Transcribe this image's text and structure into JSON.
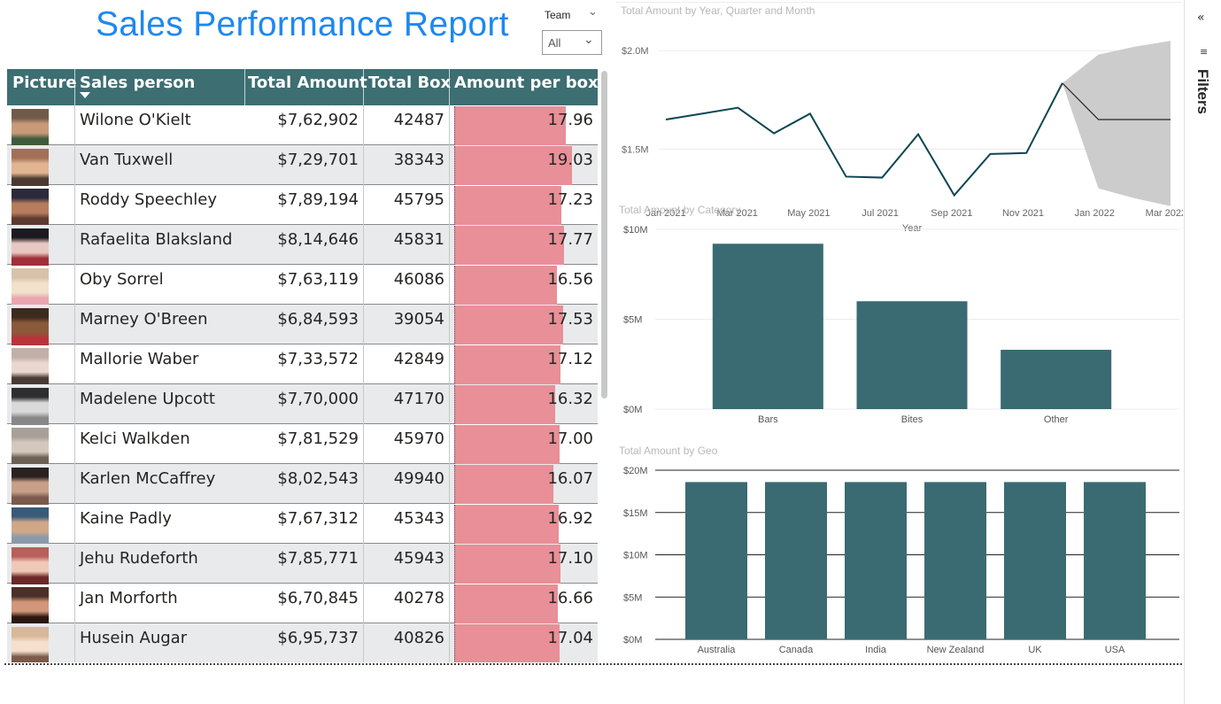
{
  "report": {
    "title": "Sales Performance Report"
  },
  "slicer": {
    "label": "Team",
    "value": "All"
  },
  "table": {
    "headers": [
      "Picture",
      "Sales person",
      "Total Amount",
      "Total Box",
      "Amount per box"
    ],
    "bar_color": "#e88f97",
    "header_color": "#3c6e72",
    "rows": [
      {
        "name": "Wilone O'Kielt",
        "amount": "$7,62,902",
        "boxes": "42487",
        "apb": "17.96",
        "apb_value": 17.96,
        "avatar": "avatar-photo-1"
      },
      {
        "name": "Van Tuxwell",
        "amount": "$7,29,701",
        "boxes": "38343",
        "apb": "19.03",
        "apb_value": 19.03,
        "avatar": "avatar-photo-2"
      },
      {
        "name": "Roddy Speechley",
        "amount": "$7,89,194",
        "boxes": "45795",
        "apb": "17.23",
        "apb_value": 17.23,
        "avatar": "avatar-photo-3"
      },
      {
        "name": "Rafaelita Blaksland",
        "amount": "$8,14,646",
        "boxes": "45831",
        "apb": "17.77",
        "apb_value": 17.77,
        "avatar": "avatar-photo-4"
      },
      {
        "name": "Oby Sorrel",
        "amount": "$7,63,119",
        "boxes": "46086",
        "apb": "16.56",
        "apb_value": 16.56,
        "avatar": "avatar-photo-5"
      },
      {
        "name": "Marney O'Breen",
        "amount": "$6,84,593",
        "boxes": "39054",
        "apb": "17.53",
        "apb_value": 17.53,
        "avatar": "avatar-photo-6"
      },
      {
        "name": "Mallorie Waber",
        "amount": "$7,33,572",
        "boxes": "42849",
        "apb": "17.12",
        "apb_value": 17.12,
        "avatar": "avatar-photo-7"
      },
      {
        "name": "Madelene Upcott",
        "amount": "$7,70,000",
        "boxes": "47170",
        "apb": "16.32",
        "apb_value": 16.32,
        "avatar": "avatar-photo-8"
      },
      {
        "name": "Kelci Walkden",
        "amount": "$7,81,529",
        "boxes": "45970",
        "apb": "17.00",
        "apb_value": 17.0,
        "avatar": "avatar-photo-9"
      },
      {
        "name": "Karlen McCaffrey",
        "amount": "$8,02,543",
        "boxes": "49940",
        "apb": "16.07",
        "apb_value": 16.07,
        "avatar": "avatar-photo-10"
      },
      {
        "name": "Kaine Padly",
        "amount": "$7,67,312",
        "boxes": "45343",
        "apb": "16.92",
        "apb_value": 16.92,
        "avatar": "avatar-photo-11"
      },
      {
        "name": "Jehu Rudeforth",
        "amount": "$7,85,771",
        "boxes": "45943",
        "apb": "17.10",
        "apb_value": 17.1,
        "avatar": "avatar-photo-12"
      },
      {
        "name": "Jan Morforth",
        "amount": "$6,70,845",
        "boxes": "40278",
        "apb": "16.66",
        "apb_value": 16.66,
        "avatar": "avatar-photo-13"
      },
      {
        "name": "Husein Augar",
        "amount": "$6,95,737",
        "boxes": "40826",
        "apb": "17.04",
        "apb_value": 17.04,
        "avatar": "avatar-photo-14"
      }
    ]
  },
  "filters": {
    "label": "Filters",
    "collapse_icon": "double-chevron-left-icon",
    "filter_icon": "filter-bars-icon"
  },
  "chart_data": [
    {
      "type": "line",
      "title": "Total Amount by Year, Quarter and Month",
      "xlabel": "Year",
      "ylabel": "",
      "tick_labels": [
        "Jan 2021",
        "Mar 2021",
        "May 2021",
        "Jul 2021",
        "Sep 2021",
        "Nov 2021",
        "Jan 2022",
        "Mar 2022"
      ],
      "y_ticks": [
        "$1.5M",
        "$2.0M"
      ],
      "ylim": [
        1.2,
        2.1
      ],
      "x": [
        "Jan 2021",
        "Feb 2021",
        "Mar 2021",
        "Apr 2021",
        "May 2021",
        "Jun 2021",
        "Jul 2021",
        "Aug 2021",
        "Sep 2021",
        "Oct 2021",
        "Nov 2021",
        "Dec 2021"
      ],
      "values": [
        1.65,
        1.68,
        1.71,
        1.58,
        1.68,
        1.36,
        1.355,
        1.575,
        1.265,
        1.475,
        1.48,
        1.835
      ],
      "forecast": {
        "x": [
          "Dec 2021",
          "Jan 2022",
          "Feb 2022",
          "Mar 2022"
        ],
        "values": [
          1.835,
          1.65,
          1.65,
          1.65
        ],
        "upper": [
          1.835,
          1.98,
          2.02,
          2.05
        ],
        "lower": [
          1.835,
          1.3,
          1.25,
          1.21
        ]
      },
      "line_color": "#0d4650",
      "band_color": "#cccccc"
    },
    {
      "type": "bar",
      "title": "Total Amount by Category",
      "categories": [
        "Bars",
        "Bites",
        "Other"
      ],
      "values": [
        9.2,
        6.0,
        3.3
      ],
      "y_ticks": [
        "$0M",
        "$5M",
        "$10M"
      ],
      "ylim": [
        0,
        10
      ],
      "bar_color": "#3a6b72"
    },
    {
      "type": "bar",
      "title": "Total Amount by Geo",
      "categories": [
        "Australia",
        "Canada",
        "India",
        "New Zealand",
        "UK",
        "USA"
      ],
      "values": [
        18.6,
        18.6,
        18.6,
        18.6,
        18.6,
        18.6
      ],
      "y_ticks": [
        "$0M",
        "$5M",
        "$10M",
        "$15M",
        "$20M"
      ],
      "ylim": [
        0,
        20
      ],
      "bar_color": "#3a6b72"
    }
  ]
}
